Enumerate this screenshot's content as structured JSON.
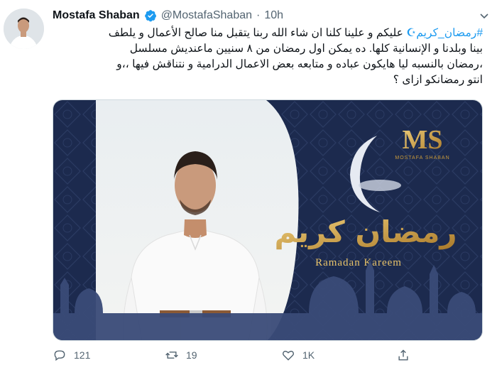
{
  "tweet": {
    "author_name": "Mostafa Shaban",
    "handle": "@MostafaShaban",
    "separator": "·",
    "time": "10h",
    "hashtag": "#رمضان_كريم",
    "line1": "عليكم و علينا كلنا ان شاء الله ربنا يتقبل منا صالح الأعمال و يلطف",
    "line2": "بينا وبلدنا و الإنسانية كلها. ده يمكن اول رمضان من ٨ سنيين ماعنديش مسلسل",
    "line3": "،رمضان بالنسبه ليا هايكون عباده و متابعه بعض الاعمال الدرامية و نتناقش فيها ،،و",
    "line4": "انتو رمضانكو ازاى ؟"
  },
  "media": {
    "logo_letters": "MS",
    "logo_name": "MOSTAFA SHABAN",
    "arabic_greeting": "رمضان كريم",
    "english_greeting": "Ramadan Kareem"
  },
  "actions": {
    "reply_count": "121",
    "retweet_count": "19",
    "like_count": "1K"
  },
  "colors": {
    "accent": "#1d9bf0",
    "navy": "#1c2a4e",
    "gold": "#c89a3c"
  },
  "icons": [
    "verified-badge-icon",
    "caret-down-icon",
    "reply-icon",
    "retweet-icon",
    "like-icon",
    "share-icon"
  ]
}
